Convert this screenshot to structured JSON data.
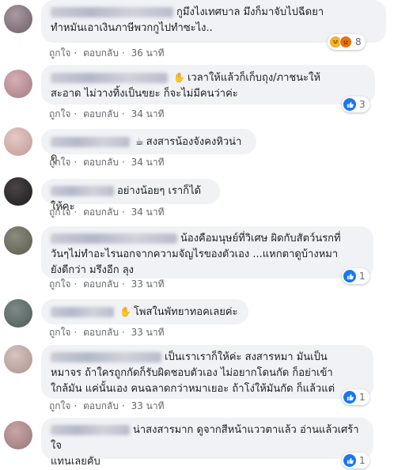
{
  "actions": {
    "like": "ถูกใจ",
    "reply": "ตอบกลับ",
    "sep": "·"
  },
  "comments": [
    {
      "text": "กูมึงไงเทศบาล มึงก็มาจับไปฉีดยา\nทำหมันเอาเงินภาษีพวกกูไปทำซะไง..",
      "time": "36 นาที",
      "reactions": "8",
      "reaction_types": [
        "haha-icon",
        "angry-icon"
      ]
    },
    {
      "text": "เวลาให้แล้วก็เก็บถุง/ภาชนะให้\nสะอาด ไม่วางทิ้งเป็นขยะ ก็จะไม่มีคนว่าค่ะ",
      "time": "34 นาที",
      "reactions": "3",
      "emoji_icon": "waving-hand-icon"
    },
    {
      "text": "สงสารน้องจังคงหิวน่าดู",
      "time": "34 นาที",
      "emoji_icon": "coffee-icon"
    },
    {
      "text": "อย่างน้อยๆ เราก็ได้ให้คะ",
      "time": "34 นาที"
    },
    {
      "text": "น้องคือมนุษย์ที่วิเศษ ผิดกับสัตว์นรกที่\nวันๆไม่ทำอะไรนอกจากความจัญไรของตัวเอง ...แหกตาดูบ้างหมา\nยังดีกว่า มรึงอีก ลุง",
      "time": "33 นาที",
      "reactions": "1"
    },
    {
      "text": "โพสในพัทยาทอคเลยค่ะ",
      "time": "33 นาที",
      "emoji_icon": "waving-hand-icon"
    },
    {
      "text": "เป็นเราเราก็ให้ค่ะ สงสารหมา มันเป็น\nหมาจร ถ้าใครถูกกัดก็รับผิดชอบตัวเอง ไม่อยากโดนกัด ก็อย่าเข้า\nใกล้มัน แค่นั้นเอง คนฉลาดกว่าหมาเยอะ ถ้าโง่ให้มันกัด ก็แล้วแต่",
      "time": "33 นาที",
      "reactions": "1"
    },
    {
      "text": "น่าสงสารมาก ดูจากสีหน้าแววตาแล้ว อ่านแล้วเศร้าใจ\nแทนเลยคับ",
      "reactions": "1"
    }
  ]
}
